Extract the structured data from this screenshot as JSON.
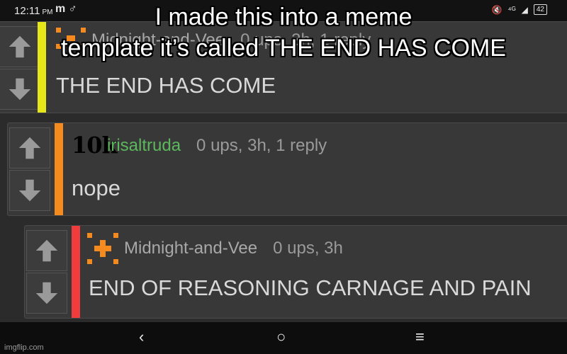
{
  "statusbar": {
    "time": "12:11",
    "ampm": "PM",
    "app_icons": "m ♂",
    "signal": "⁴ᴳ",
    "battery": "42"
  },
  "caption": {
    "line1": "I made this into a meme",
    "line2": "template it’s called THE END HAS COME"
  },
  "comments": [
    {
      "username": "Midnight-and-Vee",
      "stats": "0 ups, 3h, 1 reply",
      "body": "THE END HAS COME",
      "bar_color": "#e6e619"
    },
    {
      "rank": "10k",
      "username": "irisaltruda",
      "stats": "0 ups, 3h, 1 reply",
      "body": "nope",
      "bar_color": "#f58a1f"
    },
    {
      "username": "Midnight-and-Vee",
      "stats": "0 ups, 3h",
      "body": "END OF REASONING CARNAGE AND PAIN",
      "bar_color": "#f03c3c"
    }
  ],
  "navbar": {
    "back": "‹",
    "home": "○",
    "menu": "≡"
  },
  "watermark": "imgflip.com",
  "colors": {
    "icon_orange": "#f58a1f"
  }
}
